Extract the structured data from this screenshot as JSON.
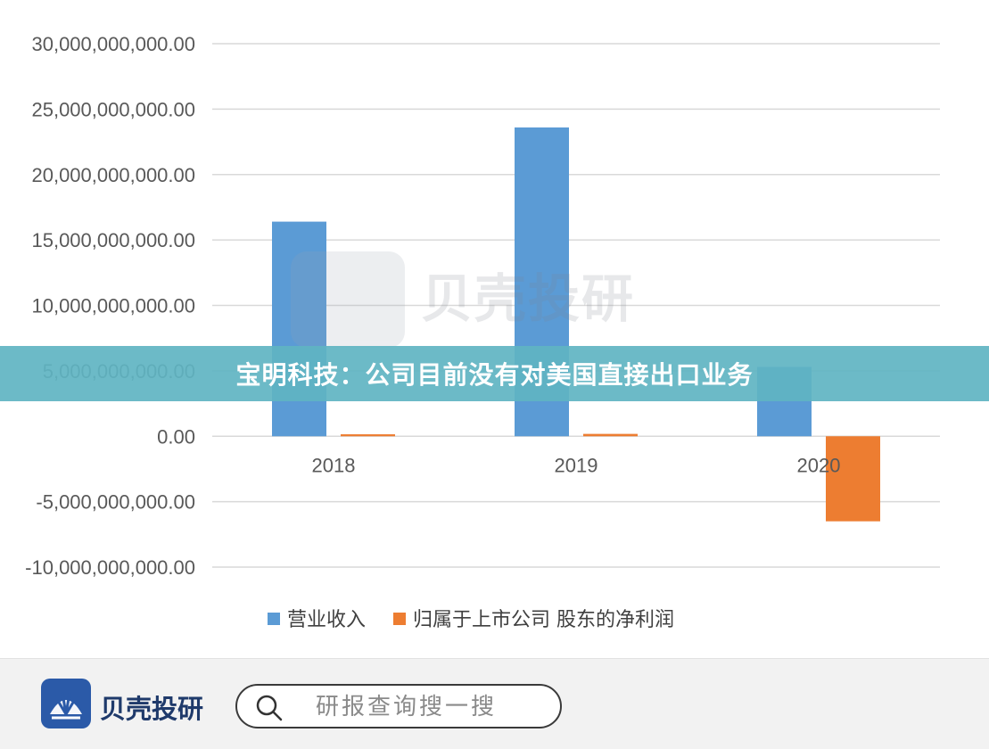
{
  "chart_data": {
    "type": "bar",
    "categories": [
      "2018",
      "2019",
      "2020"
    ],
    "series": [
      {
        "name": "营业收入",
        "color": "#5B9BD5",
        "values": [
          16400000000,
          23600000000,
          5300000000
        ]
      },
      {
        "name": "归属于上市公司 股东的净利润",
        "color": "#ED7D31",
        "values": [
          150000000,
          180000000,
          -6500000000
        ]
      }
    ],
    "yticks": [
      "30,000,000,000.00",
      "25,000,000,000.00",
      "20,000,000,000.00",
      "15,000,000,000.00",
      "10,000,000,000.00",
      "5,000,000,000.00",
      "0.00",
      "-5,000,000,000.00",
      "-10,000,000,000.00"
    ],
    "ylim": [
      -10000000000,
      30000000000
    ],
    "grid": true,
    "legend_position": "bottom"
  },
  "watermark": {
    "text": "贝壳投研",
    "logo_icon": "shell-logo-icon"
  },
  "banner": {
    "title": "宝明科技：公司目前没有对美国直接出口业务"
  },
  "footer": {
    "brand_name": "贝壳投研",
    "brand_icon": "shell-logo-icon",
    "search_icon": "search-icon",
    "search_placeholder": "研报查询搜一搜"
  }
}
